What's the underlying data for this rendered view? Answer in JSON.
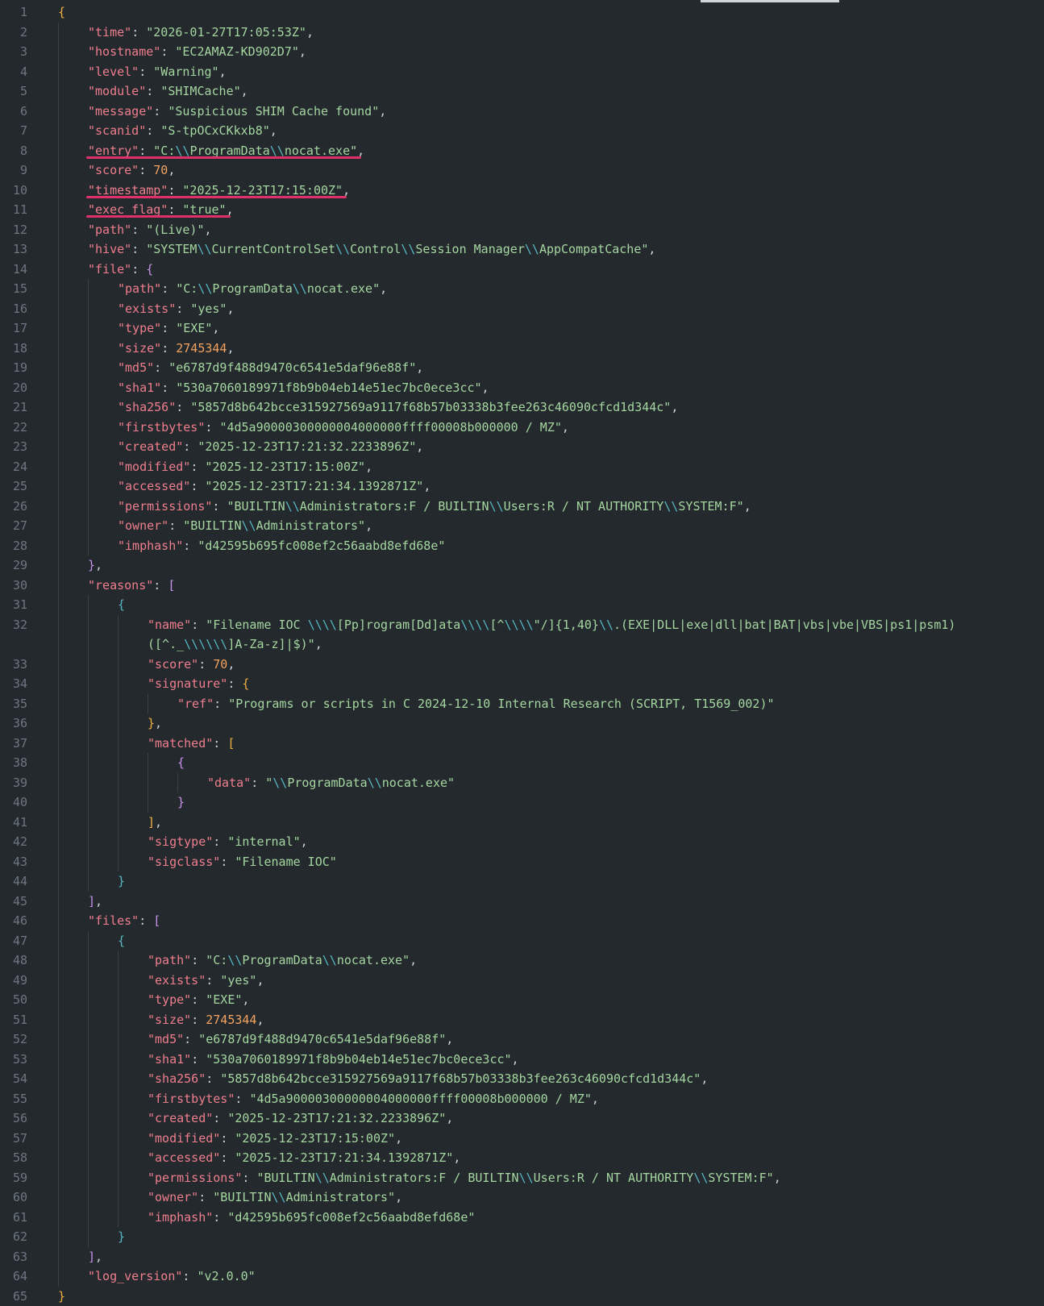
{
  "lines": [
    {
      "n": "1",
      "d": 0,
      "t": [
        [
          "br",
          "{"
        ]
      ]
    },
    {
      "n": "2",
      "d": 1,
      "t": [
        [
          "k",
          "\"time\""
        ],
        [
          "p",
          ": "
        ],
        [
          "s",
          "\"2026-01-27T17:05:53Z\""
        ],
        [
          "p",
          ","
        ]
      ]
    },
    {
      "n": "3",
      "d": 1,
      "t": [
        [
          "k",
          "\"hostname\""
        ],
        [
          "p",
          ": "
        ],
        [
          "s",
          "\"EC2AMAZ-KD902D7\""
        ],
        [
          "p",
          ","
        ]
      ]
    },
    {
      "n": "4",
      "d": 1,
      "t": [
        [
          "k",
          "\"level\""
        ],
        [
          "p",
          ": "
        ],
        [
          "s",
          "\"Warning\""
        ],
        [
          "p",
          ","
        ]
      ]
    },
    {
      "n": "5",
      "d": 1,
      "t": [
        [
          "k",
          "\"module\""
        ],
        [
          "p",
          ": "
        ],
        [
          "s",
          "\"SHIMCache\""
        ],
        [
          "p",
          ","
        ]
      ]
    },
    {
      "n": "6",
      "d": 1,
      "t": [
        [
          "k",
          "\"message\""
        ],
        [
          "p",
          ": "
        ],
        [
          "s",
          "\"Suspicious SHIM Cache found\""
        ],
        [
          "p",
          ","
        ]
      ]
    },
    {
      "n": "7",
      "d": 1,
      "t": [
        [
          "k",
          "\"scanid\""
        ],
        [
          "p",
          ": "
        ],
        [
          "s",
          "\"S-tpOCxCKkxb8\""
        ],
        [
          "p",
          ","
        ]
      ]
    },
    {
      "n": "8",
      "d": 1,
      "hl": true,
      "t": [
        [
          "k",
          "\"entry\""
        ],
        [
          "p",
          ": "
        ],
        [
          "s",
          "\"C:"
        ],
        [
          "esc",
          "\\\\"
        ],
        [
          "s",
          "ProgramData"
        ],
        [
          "esc",
          "\\\\"
        ],
        [
          "s",
          "nocat.exe\""
        ],
        [
          "p",
          ","
        ]
      ]
    },
    {
      "n": "9",
      "d": 1,
      "t": [
        [
          "k",
          "\"score\""
        ],
        [
          "p",
          ": "
        ],
        [
          "n",
          "70"
        ],
        [
          "p",
          ","
        ]
      ]
    },
    {
      "n": "10",
      "d": 1,
      "hl": true,
      "t": [
        [
          "k",
          "\"timestamp\""
        ],
        [
          "p",
          ": "
        ],
        [
          "s",
          "\"2025-12-23T17:15:00Z\""
        ],
        [
          "p",
          ","
        ]
      ]
    },
    {
      "n": "11",
      "d": 1,
      "hl": true,
      "t": [
        [
          "k",
          "\"exec_flag\""
        ],
        [
          "p",
          ": "
        ],
        [
          "s",
          "\"true\""
        ],
        [
          "p",
          ","
        ]
      ]
    },
    {
      "n": "12",
      "d": 1,
      "t": [
        [
          "k",
          "\"path\""
        ],
        [
          "p",
          ": "
        ],
        [
          "s",
          "\"(Live)\""
        ],
        [
          "p",
          ","
        ]
      ]
    },
    {
      "n": "13",
      "d": 1,
      "t": [
        [
          "k",
          "\"hive\""
        ],
        [
          "p",
          ": "
        ],
        [
          "s",
          "\"SYSTEM"
        ],
        [
          "esc",
          "\\\\"
        ],
        [
          "s",
          "CurrentControlSet"
        ],
        [
          "esc",
          "\\\\"
        ],
        [
          "s",
          "Control"
        ],
        [
          "esc",
          "\\\\"
        ],
        [
          "s",
          "Session Manager"
        ],
        [
          "esc",
          "\\\\"
        ],
        [
          "s",
          "AppCompatCache\""
        ],
        [
          "p",
          ","
        ]
      ]
    },
    {
      "n": "14",
      "d": 1,
      "t": [
        [
          "k",
          "\"file\""
        ],
        [
          "p",
          ": "
        ],
        [
          "bp",
          "{"
        ]
      ]
    },
    {
      "n": "15",
      "d": 2,
      "t": [
        [
          "k",
          "\"path\""
        ],
        [
          "p",
          ": "
        ],
        [
          "s",
          "\"C:"
        ],
        [
          "esc",
          "\\\\"
        ],
        [
          "s",
          "ProgramData"
        ],
        [
          "esc",
          "\\\\"
        ],
        [
          "s",
          "nocat.exe\""
        ],
        [
          "p",
          ","
        ]
      ]
    },
    {
      "n": "16",
      "d": 2,
      "t": [
        [
          "k",
          "\"exists\""
        ],
        [
          "p",
          ": "
        ],
        [
          "s",
          "\"yes\""
        ],
        [
          "p",
          ","
        ]
      ]
    },
    {
      "n": "17",
      "d": 2,
      "t": [
        [
          "k",
          "\"type\""
        ],
        [
          "p",
          ": "
        ],
        [
          "s",
          "\"EXE\""
        ],
        [
          "p",
          ","
        ]
      ]
    },
    {
      "n": "18",
      "d": 2,
      "t": [
        [
          "k",
          "\"size\""
        ],
        [
          "p",
          ": "
        ],
        [
          "n",
          "2745344"
        ],
        [
          "p",
          ","
        ]
      ]
    },
    {
      "n": "19",
      "d": 2,
      "t": [
        [
          "k",
          "\"md5\""
        ],
        [
          "p",
          ": "
        ],
        [
          "s",
          "\"e6787d9f488d9470c6541e5daf96e88f\""
        ],
        [
          "p",
          ","
        ]
      ]
    },
    {
      "n": "20",
      "d": 2,
      "t": [
        [
          "k",
          "\"sha1\""
        ],
        [
          "p",
          ": "
        ],
        [
          "s",
          "\"530a7060189971f8b9b04eb14e51ec7bc0ece3cc\""
        ],
        [
          "p",
          ","
        ]
      ]
    },
    {
      "n": "21",
      "d": 2,
      "t": [
        [
          "k",
          "\"sha256\""
        ],
        [
          "p",
          ": "
        ],
        [
          "s",
          "\"5857d8b642bcce315927569a9117f68b57b03338b3fee263c46090cfcd1d344c\""
        ],
        [
          "p",
          ","
        ]
      ]
    },
    {
      "n": "22",
      "d": 2,
      "t": [
        [
          "k",
          "\"firstbytes\""
        ],
        [
          "p",
          ": "
        ],
        [
          "s",
          "\"4d5a90000300000004000000ffff00008b000000 / MZ\""
        ],
        [
          "p",
          ","
        ]
      ]
    },
    {
      "n": "23",
      "d": 2,
      "t": [
        [
          "k",
          "\"created\""
        ],
        [
          "p",
          ": "
        ],
        [
          "s",
          "\"2025-12-23T17:21:32.2233896Z\""
        ],
        [
          "p",
          ","
        ]
      ]
    },
    {
      "n": "24",
      "d": 2,
      "t": [
        [
          "k",
          "\"modified\""
        ],
        [
          "p",
          ": "
        ],
        [
          "s",
          "\"2025-12-23T17:15:00Z\""
        ],
        [
          "p",
          ","
        ]
      ]
    },
    {
      "n": "25",
      "d": 2,
      "t": [
        [
          "k",
          "\"accessed\""
        ],
        [
          "p",
          ": "
        ],
        [
          "s",
          "\"2025-12-23T17:21:34.1392871Z\""
        ],
        [
          "p",
          ","
        ]
      ]
    },
    {
      "n": "26",
      "d": 2,
      "t": [
        [
          "k",
          "\"permissions\""
        ],
        [
          "p",
          ": "
        ],
        [
          "s",
          "\"BUILTIN"
        ],
        [
          "esc",
          "\\\\"
        ],
        [
          "s",
          "Administrators:F / BUILTIN"
        ],
        [
          "esc",
          "\\\\"
        ],
        [
          "s",
          "Users:R / NT AUTHORITY"
        ],
        [
          "esc",
          "\\\\"
        ],
        [
          "s",
          "SYSTEM:F\""
        ],
        [
          "p",
          ","
        ]
      ]
    },
    {
      "n": "27",
      "d": 2,
      "t": [
        [
          "k",
          "\"owner\""
        ],
        [
          "p",
          ": "
        ],
        [
          "s",
          "\"BUILTIN"
        ],
        [
          "esc",
          "\\\\"
        ],
        [
          "s",
          "Administrators\""
        ],
        [
          "p",
          ","
        ]
      ]
    },
    {
      "n": "28",
      "d": 2,
      "t": [
        [
          "k",
          "\"imphash\""
        ],
        [
          "p",
          ": "
        ],
        [
          "s",
          "\"d42595b695fc008ef2c56aabd8efd68e\""
        ]
      ]
    },
    {
      "n": "29",
      "d": 1,
      "t": [
        [
          "bp",
          "}"
        ],
        [
          "p",
          ","
        ]
      ]
    },
    {
      "n": "30",
      "d": 1,
      "t": [
        [
          "k",
          "\"reasons\""
        ],
        [
          "p",
          ": "
        ],
        [
          "bp",
          "["
        ]
      ]
    },
    {
      "n": "31",
      "d": 2,
      "t": [
        [
          "bc",
          "{"
        ]
      ]
    },
    {
      "n": "32",
      "d": 3,
      "wrap": true,
      "t": [
        [
          "k",
          "\"name\""
        ],
        [
          "p",
          ": "
        ],
        [
          "s",
          "\"Filename IOC "
        ],
        [
          "esc",
          "\\\\\\\\"
        ],
        [
          "s",
          "[Pp]rogram[Dd]ata"
        ],
        [
          "esc",
          "\\\\\\\\"
        ],
        [
          "s",
          "[^"
        ],
        [
          "esc",
          "\\\\\\\\"
        ],
        [
          "s",
          "\"/]{1,40}"
        ],
        [
          "esc",
          "\\\\"
        ],
        [
          "s",
          ".(EXE|DLL|exe|dll|bat|BAT|vbs|vbe|VBS|ps1|psm1)([^."
        ],
        [
          "s",
          "_"
        ],
        [
          "esc",
          "\\\\\\\\\\\\"
        ],
        [
          "s",
          "]A-Za-z]|$)\""
        ],
        [
          "p",
          ","
        ]
      ]
    },
    {
      "n": "33",
      "d": 3,
      "t": [
        [
          "k",
          "\"score\""
        ],
        [
          "p",
          ": "
        ],
        [
          "n",
          "70"
        ],
        [
          "p",
          ","
        ]
      ]
    },
    {
      "n": "34",
      "d": 3,
      "t": [
        [
          "k",
          "\"signature\""
        ],
        [
          "p",
          ": "
        ],
        [
          "br",
          "{"
        ]
      ]
    },
    {
      "n": "35",
      "d": 4,
      "t": [
        [
          "k",
          "\"ref\""
        ],
        [
          "p",
          ": "
        ],
        [
          "s",
          "\"Programs or scripts in C 2024-12-10 Internal Research (SCRIPT, T1569_002)\""
        ]
      ]
    },
    {
      "n": "36",
      "d": 3,
      "t": [
        [
          "br",
          "}"
        ],
        [
          "p",
          ","
        ]
      ]
    },
    {
      "n": "37",
      "d": 3,
      "t": [
        [
          "k",
          "\"matched\""
        ],
        [
          "p",
          ": "
        ],
        [
          "br",
          "["
        ]
      ]
    },
    {
      "n": "38",
      "d": 4,
      "t": [
        [
          "bp",
          "{"
        ]
      ]
    },
    {
      "n": "39",
      "d": 5,
      "t": [
        [
          "k",
          "\"data\""
        ],
        [
          "p",
          ": "
        ],
        [
          "s",
          "\""
        ],
        [
          "esc",
          "\\\\"
        ],
        [
          "s",
          "ProgramData"
        ],
        [
          "esc",
          "\\\\"
        ],
        [
          "s",
          "nocat.exe\""
        ]
      ]
    },
    {
      "n": "40",
      "d": 4,
      "t": [
        [
          "bp",
          "}"
        ]
      ]
    },
    {
      "n": "41",
      "d": 3,
      "t": [
        [
          "br",
          "]"
        ],
        [
          "p",
          ","
        ]
      ]
    },
    {
      "n": "42",
      "d": 3,
      "t": [
        [
          "k",
          "\"sigtype\""
        ],
        [
          "p",
          ": "
        ],
        [
          "s",
          "\"internal\""
        ],
        [
          "p",
          ","
        ]
      ]
    },
    {
      "n": "43",
      "d": 3,
      "t": [
        [
          "k",
          "\"sigclass\""
        ],
        [
          "p",
          ": "
        ],
        [
          "s",
          "\"Filename IOC\""
        ]
      ]
    },
    {
      "n": "44",
      "d": 2,
      "t": [
        [
          "bc",
          "}"
        ]
      ]
    },
    {
      "n": "45",
      "d": 1,
      "t": [
        [
          "bp",
          "]"
        ],
        [
          "p",
          ","
        ]
      ]
    },
    {
      "n": "46",
      "d": 1,
      "t": [
        [
          "k",
          "\"files\""
        ],
        [
          "p",
          ": "
        ],
        [
          "bp",
          "["
        ]
      ]
    },
    {
      "n": "47",
      "d": 2,
      "t": [
        [
          "bc",
          "{"
        ]
      ]
    },
    {
      "n": "48",
      "d": 3,
      "t": [
        [
          "k",
          "\"path\""
        ],
        [
          "p",
          ": "
        ],
        [
          "s",
          "\"C:"
        ],
        [
          "esc",
          "\\\\"
        ],
        [
          "s",
          "ProgramData"
        ],
        [
          "esc",
          "\\\\"
        ],
        [
          "s",
          "nocat.exe\""
        ],
        [
          "p",
          ","
        ]
      ]
    },
    {
      "n": "49",
      "d": 3,
      "t": [
        [
          "k",
          "\"exists\""
        ],
        [
          "p",
          ": "
        ],
        [
          "s",
          "\"yes\""
        ],
        [
          "p",
          ","
        ]
      ]
    },
    {
      "n": "50",
      "d": 3,
      "t": [
        [
          "k",
          "\"type\""
        ],
        [
          "p",
          ": "
        ],
        [
          "s",
          "\"EXE\""
        ],
        [
          "p",
          ","
        ]
      ]
    },
    {
      "n": "51",
      "d": 3,
      "t": [
        [
          "k",
          "\"size\""
        ],
        [
          "p",
          ": "
        ],
        [
          "n",
          "2745344"
        ],
        [
          "p",
          ","
        ]
      ]
    },
    {
      "n": "52",
      "d": 3,
      "t": [
        [
          "k",
          "\"md5\""
        ],
        [
          "p",
          ": "
        ],
        [
          "s",
          "\"e6787d9f488d9470c6541e5daf96e88f\""
        ],
        [
          "p",
          ","
        ]
      ]
    },
    {
      "n": "53",
      "d": 3,
      "t": [
        [
          "k",
          "\"sha1\""
        ],
        [
          "p",
          ": "
        ],
        [
          "s",
          "\"530a7060189971f8b9b04eb14e51ec7bc0ece3cc\""
        ],
        [
          "p",
          ","
        ]
      ]
    },
    {
      "n": "54",
      "d": 3,
      "t": [
        [
          "k",
          "\"sha256\""
        ],
        [
          "p",
          ": "
        ],
        [
          "s",
          "\"5857d8b642bcce315927569a9117f68b57b03338b3fee263c46090cfcd1d344c\""
        ],
        [
          "p",
          ","
        ]
      ]
    },
    {
      "n": "55",
      "d": 3,
      "t": [
        [
          "k",
          "\"firstbytes\""
        ],
        [
          "p",
          ": "
        ],
        [
          "s",
          "\"4d5a90000300000004000000ffff00008b000000 / MZ\""
        ],
        [
          "p",
          ","
        ]
      ]
    },
    {
      "n": "56",
      "d": 3,
      "t": [
        [
          "k",
          "\"created\""
        ],
        [
          "p",
          ": "
        ],
        [
          "s",
          "\"2025-12-23T17:21:32.2233896Z\""
        ],
        [
          "p",
          ","
        ]
      ]
    },
    {
      "n": "57",
      "d": 3,
      "t": [
        [
          "k",
          "\"modified\""
        ],
        [
          "p",
          ": "
        ],
        [
          "s",
          "\"2025-12-23T17:15:00Z\""
        ],
        [
          "p",
          ","
        ]
      ]
    },
    {
      "n": "58",
      "d": 3,
      "t": [
        [
          "k",
          "\"accessed\""
        ],
        [
          "p",
          ": "
        ],
        [
          "s",
          "\"2025-12-23T17:21:34.1392871Z\""
        ],
        [
          "p",
          ","
        ]
      ]
    },
    {
      "n": "59",
      "d": 3,
      "t": [
        [
          "k",
          "\"permissions\""
        ],
        [
          "p",
          ": "
        ],
        [
          "s",
          "\"BUILTIN"
        ],
        [
          "esc",
          "\\\\"
        ],
        [
          "s",
          "Administrators:F / BUILTIN"
        ],
        [
          "esc",
          "\\\\"
        ],
        [
          "s",
          "Users:R / NT AUTHORITY"
        ],
        [
          "esc",
          "\\\\"
        ],
        [
          "s",
          "SYSTEM:F\""
        ],
        [
          "p",
          ","
        ]
      ]
    },
    {
      "n": "60",
      "d": 3,
      "t": [
        [
          "k",
          "\"owner\""
        ],
        [
          "p",
          ": "
        ],
        [
          "s",
          "\"BUILTIN"
        ],
        [
          "esc",
          "\\\\"
        ],
        [
          "s",
          "Administrators\""
        ],
        [
          "p",
          ","
        ]
      ]
    },
    {
      "n": "61",
      "d": 3,
      "t": [
        [
          "k",
          "\"imphash\""
        ],
        [
          "p",
          ": "
        ],
        [
          "s",
          "\"d42595b695fc008ef2c56aabd8efd68e\""
        ]
      ]
    },
    {
      "n": "62",
      "d": 2,
      "t": [
        [
          "bc",
          "}"
        ]
      ]
    },
    {
      "n": "63",
      "d": 1,
      "t": [
        [
          "bp",
          "]"
        ],
        [
          "p",
          ","
        ]
      ]
    },
    {
      "n": "64",
      "d": 1,
      "t": [
        [
          "k",
          "\"log_version\""
        ],
        [
          "p",
          ": "
        ],
        [
          "s",
          "\"v2.0.0\""
        ]
      ]
    },
    {
      "n": "65",
      "d": 0,
      "t": [
        [
          "br",
          "}"
        ]
      ]
    }
  ]
}
